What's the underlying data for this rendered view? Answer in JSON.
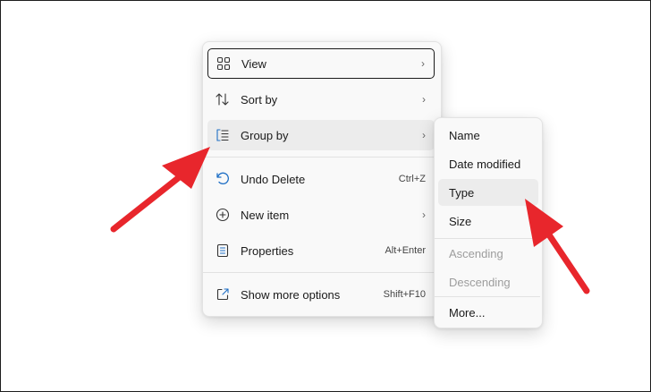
{
  "context_menu": {
    "items": [
      {
        "label": "View",
        "icon": "grid-view-icon",
        "has_submenu": true
      },
      {
        "label": "Sort by",
        "icon": "sort-icon",
        "has_submenu": true
      },
      {
        "label": "Group by",
        "icon": "group-by-icon",
        "has_submenu": true
      },
      {
        "label": "Undo Delete",
        "icon": "undo-icon",
        "shortcut": "Ctrl+Z"
      },
      {
        "label": "New item",
        "icon": "plus-circle-icon",
        "has_submenu": true
      },
      {
        "label": "Properties",
        "icon": "properties-icon",
        "shortcut": "Alt+Enter"
      },
      {
        "label": "Show more options",
        "icon": "share-icon",
        "shortcut": "Shift+F10"
      }
    ]
  },
  "group_by_submenu": {
    "items": [
      {
        "label": "Name"
      },
      {
        "label": "Date modified"
      },
      {
        "label": "Type"
      },
      {
        "label": "Size"
      },
      {
        "label": "Ascending",
        "disabled": true
      },
      {
        "label": "Descending",
        "disabled": true
      },
      {
        "label": "More..."
      }
    ]
  },
  "colors": {
    "accent_icon": "#1f6fc5",
    "annotation_arrow": "#e8262c",
    "hover_bg": "#ececec"
  }
}
